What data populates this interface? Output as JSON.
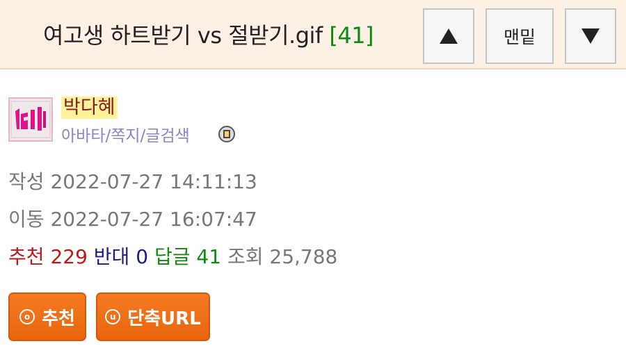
{
  "post": {
    "title": "여고생 하트받기 vs 절받기.gif",
    "comment_count": "[41]"
  },
  "nav": {
    "up_icon": "triangle-up-icon",
    "bottom_label": "맨밑",
    "down_icon": "triangle-down-icon"
  },
  "author": {
    "name": "박다혜",
    "links": "아바타/쪽지/글검색"
  },
  "meta": {
    "created_label": "작성",
    "created_at": "2022-07-27 14:11:13",
    "moved_label": "이동",
    "moved_at": "2022-07-27 16:07:47"
  },
  "stats": {
    "recommend_label": "추천",
    "recommend": "229",
    "oppose_label": "반대",
    "oppose": "0",
    "replies_label": "답글",
    "replies": "41",
    "views_label": "조회",
    "views": "25,788"
  },
  "actions": {
    "recommend_label": "추천",
    "shorturl_label": "단축URL"
  },
  "colors": {
    "header_bg": "#fdf0e4",
    "button_orange": "#f0711a",
    "recommend_red": "#c01818",
    "oppose_blue": "#1a1a8f",
    "reply_green": "#108a10",
    "author_highlight": "#fff29a"
  }
}
